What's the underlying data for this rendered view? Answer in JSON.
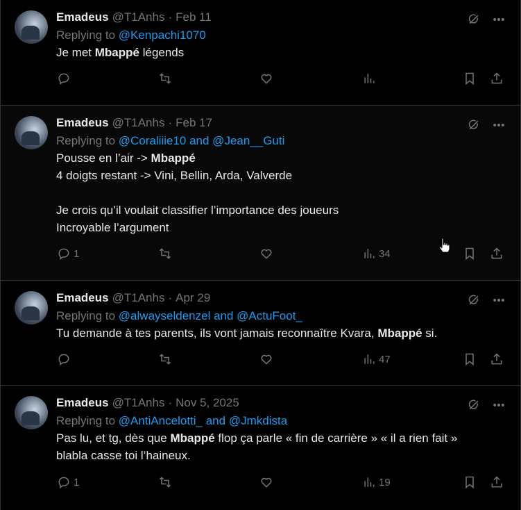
{
  "tweets": [
    {
      "name": "Emadeus",
      "handle": "@T1Anhs",
      "date": "Feb 11",
      "replying_prefix": "Replying to",
      "mentions": "@Kenpachi1070",
      "body_parts": [
        "Je met ",
        "Mbappé",
        " légends"
      ],
      "reply_count": "",
      "views": ""
    },
    {
      "name": "Emadeus",
      "handle": "@T1Anhs",
      "date": "Feb 17",
      "replying_prefix": "Replying to",
      "mentions": "@Coraliiie10 and @Jean__Guti",
      "body_parts": [
        "Pousse en l’air -> ",
        "Mbappé",
        "\n4 doigts restant -> Vini, Bellin, Arda, Valverde\n\nJe crois qu’il voulait classifier l’importance des joueurs\nIncroyable l’argument"
      ],
      "reply_count": "1",
      "views": "34"
    },
    {
      "name": "Emadeus",
      "handle": "@T1Anhs",
      "date": "Apr 29",
      "replying_prefix": "Replying to",
      "mentions": "@alwayseldenzel and @ActuFoot_",
      "body_parts": [
        "Tu demande à tes parents, ils vont jamais reconnaître Kvara, ",
        "Mbappé",
        " si."
      ],
      "reply_count": "",
      "views": "47"
    },
    {
      "name": "Emadeus",
      "handle": "@T1Anhs",
      "date": "Nov 5, 2025",
      "replying_prefix": "Replying to",
      "mentions": "@AntiAncelotti_ and @Jmkdista",
      "body_parts": [
        "Pas lu, et tg, dès que ",
        "Mbappé",
        " flop ça parle « fin de carrière » « il a rien fait »\nblabla casse toi l’haineux."
      ],
      "reply_count": "1",
      "views": "19"
    }
  ],
  "separator": "·",
  "icons": {
    "grok": "grok-icon",
    "more": "more-icon",
    "reply": "reply-icon",
    "retweet": "retweet-icon",
    "like": "like-icon",
    "views": "views-icon",
    "bookmark": "bookmark-icon",
    "share": "share-icon"
  },
  "colors": {
    "background": "#000000",
    "text": "#e7e9ea",
    "muted": "#71767b",
    "link": "#1d9bf0",
    "border": "#2f3336"
  }
}
